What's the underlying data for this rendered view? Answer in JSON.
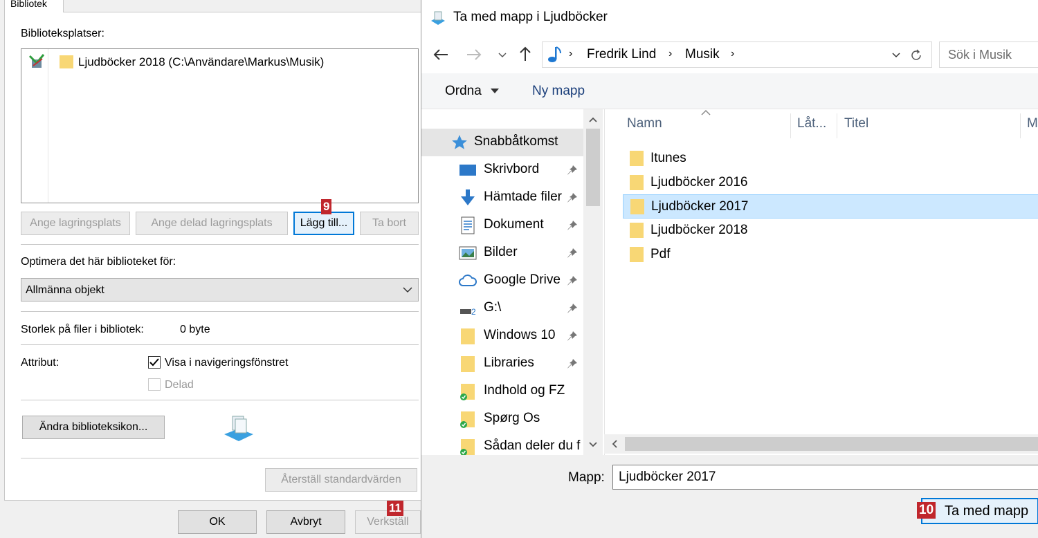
{
  "left_dialog": {
    "tab_label": "Bibliotek",
    "locations_label": "Biblioteksplatser:",
    "location_item": "Ljudböcker 2018 (C:\\Användare\\Markus\\Musik)",
    "buttons": {
      "set_location": "Ange lagringsplats",
      "set_shared": "Ange delad lagringsplats",
      "add": "Lägg till...",
      "remove": "Ta bort"
    },
    "optimize_label": "Optimera det här biblioteket för:",
    "optimize_value": "Allmänna objekt",
    "size_label": "Storlek på filer i bibliotek:",
    "size_value": "0 byte",
    "attributes_label": "Attribut:",
    "checkbox_nav": "Visa i navigeringsfönstret",
    "checkbox_nav_checked": true,
    "checkbox_shared": "Delad",
    "checkbox_shared_checked": false,
    "change_icon": "Ändra biblioteksikon...",
    "restore_defaults": "Återställ standardvärden",
    "ok": "OK",
    "cancel": "Avbryt",
    "apply": "Verkställ",
    "badge_add": "9",
    "badge_apply": "11"
  },
  "right_dialog": {
    "title": "Ta med mapp i Ljudböcker",
    "breadcrumb": [
      "Fredrik Lind",
      "Musik"
    ],
    "search_placeholder": "Sök i Musik",
    "organize": "Ordna",
    "new_folder": "Ny mapp",
    "nav_items": [
      {
        "label": "Snabbåtkomst",
        "icon": "star-icon",
        "pinned": false
      },
      {
        "label": "Skrivbord",
        "icon": "desktop-icon",
        "pinned": true
      },
      {
        "label": "Hämtade filer",
        "icon": "download-icon",
        "pinned": true
      },
      {
        "label": "Dokument",
        "icon": "document-icon",
        "pinned": true
      },
      {
        "label": "Bilder",
        "icon": "pictures-icon",
        "pinned": true
      },
      {
        "label": "Google Drive",
        "icon": "cloud-icon",
        "pinned": true
      },
      {
        "label": "G:\\",
        "icon": "drive-icon",
        "pinned": true
      },
      {
        "label": "Windows 10",
        "icon": "folder-icon",
        "pinned": true
      },
      {
        "label": "Libraries",
        "icon": "folder-icon",
        "pinned": true
      },
      {
        "label": "Indhold og FZ",
        "icon": "synced-folder-icon",
        "pinned": false
      },
      {
        "label": "Spørg Os",
        "icon": "synced-folder-icon",
        "pinned": false
      },
      {
        "label": "Sådan deler du f",
        "icon": "synced-folder-icon",
        "pinned": false
      }
    ],
    "columns": [
      "Namn",
      "Låt...",
      "Titel",
      "M"
    ],
    "files": [
      "Itunes",
      "Ljudböcker 2016",
      "Ljudböcker 2017",
      "Ljudböcker 2018",
      "Pdf"
    ],
    "selected_file": "Ljudböcker 2017",
    "folder_label": "Mapp:",
    "folder_value": "Ljudböcker 2017",
    "confirm": "Ta med mapp",
    "badge_confirm": "10"
  },
  "colors": {
    "accent": "#0078d7",
    "selection": "#cce8ff",
    "badge": "#c0272d",
    "folder": "#f8d775"
  }
}
